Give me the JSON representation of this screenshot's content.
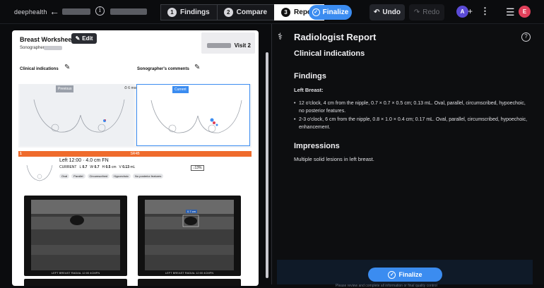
{
  "app": {
    "logo": "deephealth"
  },
  "steps": [
    {
      "num": "1",
      "label": "Findings"
    },
    {
      "num": "2",
      "label": "Compare"
    },
    {
      "num": "3",
      "label": "Report"
    }
  ],
  "toolbar": {
    "finalize": "Finalize",
    "undo": "Undo",
    "redo": "Redo",
    "avatar_a": "A",
    "avatar_e": "E",
    "plus": "+",
    "kebab": "⋮",
    "menu": "☰"
  },
  "worksheet": {
    "title": "Breast Worksheet",
    "edit": "Edit",
    "sonographer": "Sonographer:",
    "visit": "Visit 2",
    "clinical_indications": "Clinical indications",
    "sonographer_comments": "Sonographer's comments",
    "previous": "Previous",
    "current": "Current",
    "interval": "6 month",
    "lesion_bar": "SR4B",
    "lesion_num": "1",
    "lesion_title": "Left 12:00 · 4.0 cm FN",
    "current_label": "CURRENT",
    "L": "L",
    "L_val": "0.7",
    "W": "W",
    "W_val": "0.7",
    "H": "H",
    "H_val": "0.5",
    "unit_cm": "cm",
    "V": "V",
    "V_val": "0.13",
    "unit_ml": "mL",
    "pct": "↓13%",
    "chips": [
      "Oval",
      "Parallel",
      "Circumscribed",
      "Hypoechoic",
      "No posterior features"
    ],
    "us_caption_1": "LEFT BREAST RADIAL 12:00 4CMFN",
    "us_caption_2": "LEFT BREAST RADIAL 12:00 4CMFN",
    "measure": "0.7 cm"
  },
  "report": {
    "title": "Radiologist Report",
    "clinical_indications": "Clinical indications",
    "findings": "Findings",
    "left_breast": "Left Breast:",
    "finding_1": "12 o'clock, 4 cm from the nipple, 0.7 × 0.7 × 0.5 cm; 0.13 mL. Oval, parallel, circumscribed, hypoechoic, no posterior features.",
    "finding_2": "2-3 o'clock, 6 cm from the nipple, 0.8 × 1.0 × 0.4 cm; 0.17 mL. Oval, parallel, circumscribed, hypoechoic, enhancement.",
    "impressions": "Impressions",
    "impression_text": "Multiple solid lesions in left breast.",
    "finalize": "Finalize",
    "footnote": "Please review and complete all information or final quality control"
  },
  "colors": {
    "accent": "#3b8cf0",
    "lesion": "#ef6b2c",
    "avatar_a": "#5b4bd6",
    "avatar_e": "#e0405a"
  }
}
